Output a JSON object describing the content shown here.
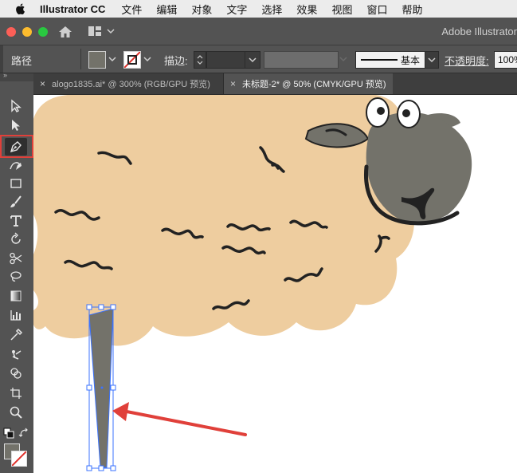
{
  "menubar": {
    "app_name": "Illustrator CC",
    "items": [
      "文件",
      "编辑",
      "对象",
      "文字",
      "选择",
      "效果",
      "视图",
      "窗口",
      "帮助"
    ]
  },
  "titlebar": {
    "title": "Adobe Illustrator"
  },
  "controlbar": {
    "selection_type": "路径",
    "stroke_label": "描边:",
    "stroke_style": "基本",
    "opacity_label": "不透明度:",
    "opacity_value": "100%",
    "fill_color": "#73726a",
    "stroke_color": "none"
  },
  "tabs": [
    {
      "label": "alogo1835.ai* @ 300% (RGB/GPU 预览)",
      "active": false
    },
    {
      "label": "未标题-2* @ 50% (CMYK/GPU 预览)",
      "active": true
    }
  ],
  "toolbar": {
    "tools": [
      "selection-tool",
      "direct-selection-tool",
      "pen-tool",
      "curvature-tool",
      "rectangle-tool",
      "paintbrush-tool",
      "type-tool",
      "rotate-tool",
      "scissors-tool",
      "lasso-tool",
      "gradient-tool",
      "graph-tool",
      "eyedropper-tool",
      "puppet-warp-tool",
      "shape-builder-tool",
      "artboard-tool",
      "zoom-tool"
    ],
    "active_tool": "pen-tool"
  },
  "colors": {
    "wool": "#eecd9f",
    "face": "#73726a",
    "dark": "#222222",
    "selection": "#3b73ff",
    "arrow": "#e0403a"
  }
}
